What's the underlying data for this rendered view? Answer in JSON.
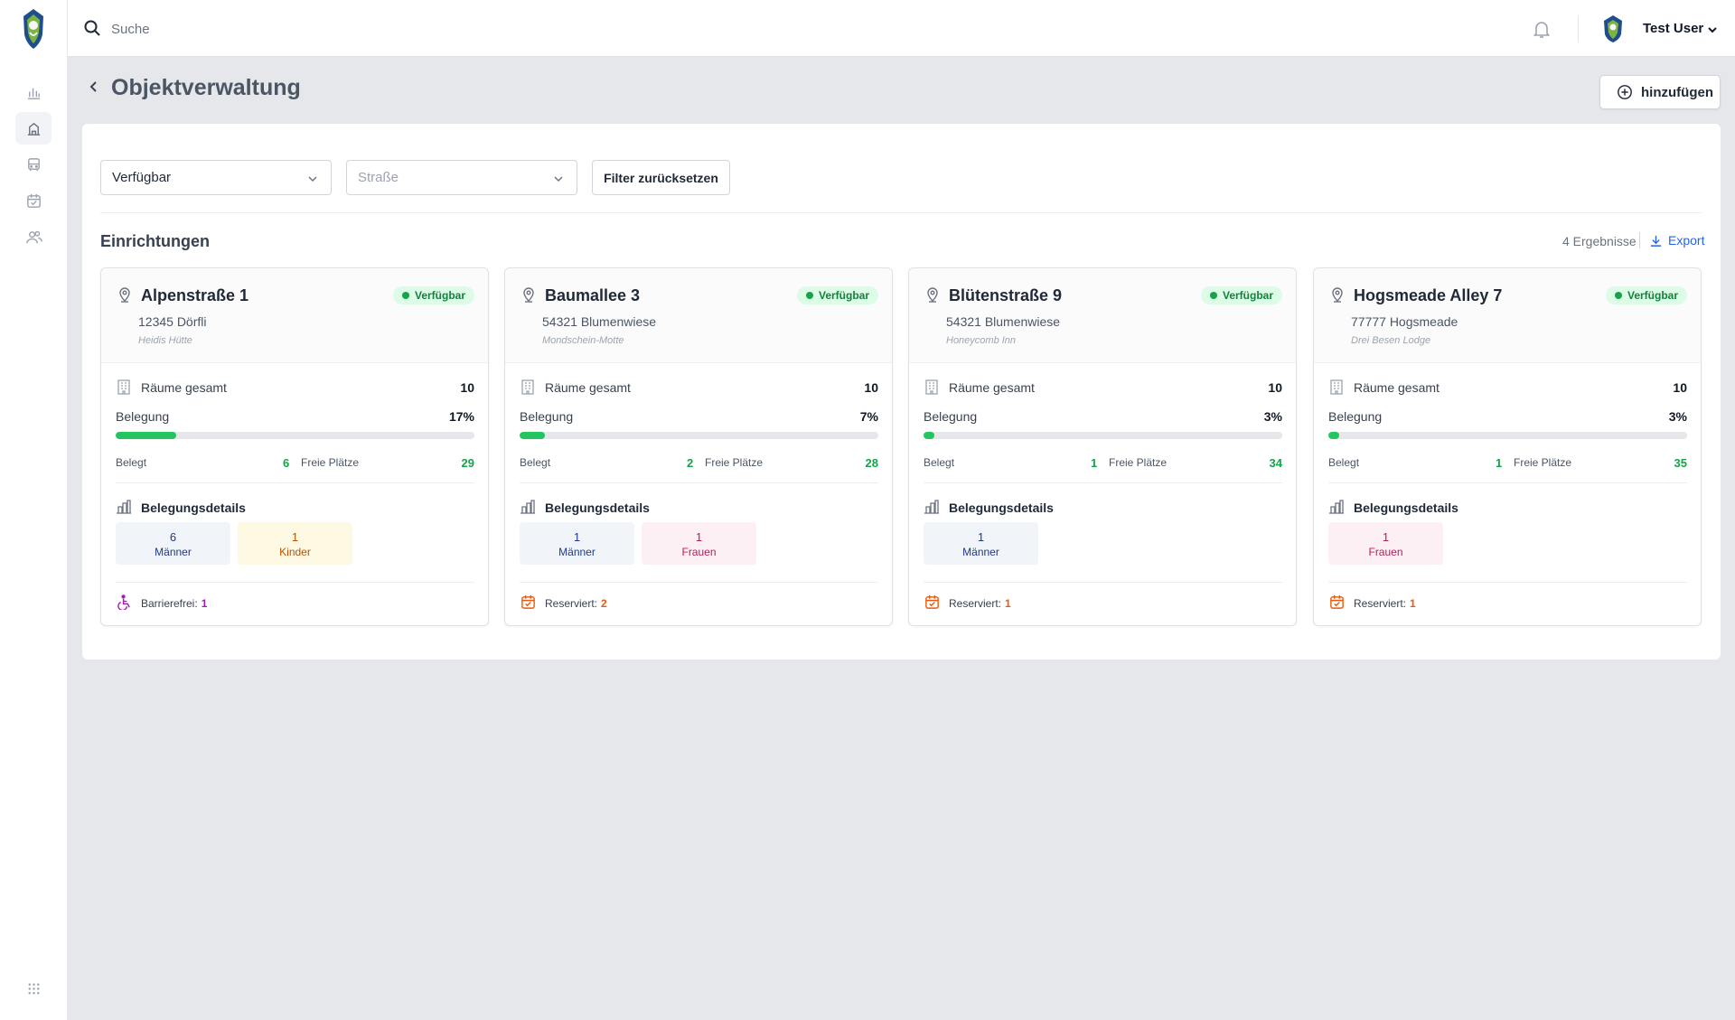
{
  "search": {
    "placeholder": "Suche"
  },
  "user": {
    "name": "Test User"
  },
  "page": {
    "title": "Objektverwaltung",
    "add_label": "hinzufügen"
  },
  "filters": {
    "status_value": "Verfügbar",
    "street_placeholder": "Straße",
    "reset_label": "Filter zurücksetzen"
  },
  "section": {
    "title": "Einrichtungen",
    "results": "4 Ergebnisse",
    "export_label": "Export"
  },
  "labels": {
    "rooms_total": "Räume gesamt",
    "occupancy": "Belegung",
    "occupied": "Belegt",
    "free_places": "Freie Plätze",
    "occupancy_details": "Belegungsdetails",
    "status": "Verfügbar"
  },
  "colors": {
    "green": "#22c55e",
    "accent": "#2563eb",
    "purple": "#a21caf",
    "orange": "#ea580c"
  },
  "cards": [
    {
      "title": "Alpenstraße 1",
      "zip_city": "12345 Dörfli",
      "name": "Heidis Hütte",
      "rooms": "10",
      "occupancy_pct": "17%",
      "occupancy_fraction": 0.17,
      "occupied": "6",
      "free": "29",
      "chips": [
        {
          "type": "men",
          "count": "6",
          "label": "Männer"
        },
        {
          "type": "kids",
          "count": "1",
          "label": "Kinder"
        }
      ],
      "footer": {
        "icon": "wheelchair-icon",
        "label": "Barrierefrei:",
        "value": "1"
      }
    },
    {
      "title": "Baumallee 3",
      "zip_city": "54321 Blumenwiese",
      "name": "Mondschein-Motte",
      "rooms": "10",
      "occupancy_pct": "7%",
      "occupancy_fraction": 0.07,
      "occupied": "2",
      "free": "28",
      "chips": [
        {
          "type": "men",
          "count": "1",
          "label": "Männer"
        },
        {
          "type": "women",
          "count": "1",
          "label": "Frauen"
        }
      ],
      "footer": {
        "icon": "calendar-check-icon",
        "label": "Reserviert:",
        "value": "2"
      }
    },
    {
      "title": "Blütenstraße 9",
      "zip_city": "54321 Blumenwiese",
      "name": "Honeycomb Inn",
      "rooms": "10",
      "occupancy_pct": "3%",
      "occupancy_fraction": 0.03,
      "occupied": "1",
      "free": "34",
      "chips": [
        {
          "type": "men",
          "count": "1",
          "label": "Männer"
        }
      ],
      "footer": {
        "icon": "calendar-check-icon",
        "label": "Reserviert:",
        "value": "1"
      }
    },
    {
      "title": "Hogsmeade Alley 7",
      "zip_city": "77777 Hogsmeade",
      "name": "Drei Besen Lodge",
      "rooms": "10",
      "occupancy_pct": "3%",
      "occupancy_fraction": 0.03,
      "occupied": "1",
      "free": "35",
      "chips": [
        {
          "type": "women",
          "count": "1",
          "label": "Frauen"
        }
      ],
      "footer": {
        "icon": "calendar-check-icon",
        "label": "Reserviert:",
        "value": "1"
      }
    }
  ]
}
